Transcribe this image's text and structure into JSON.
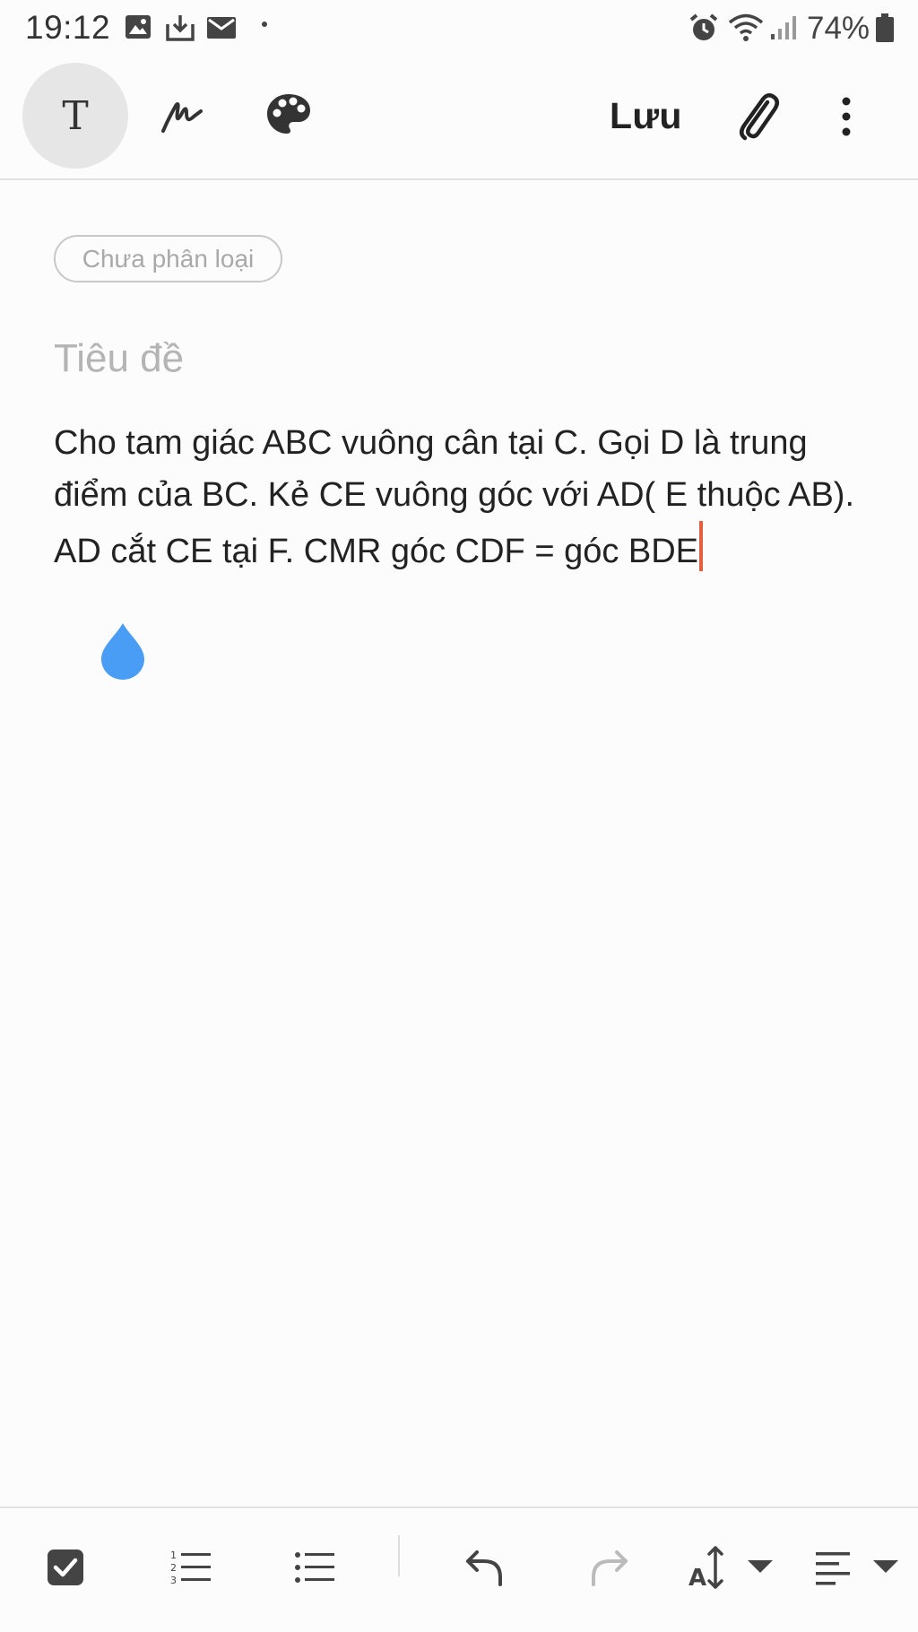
{
  "status_bar": {
    "time": "19:12",
    "battery": "74%",
    "icons": [
      "image-icon",
      "download-icon",
      "mail-icon",
      "alarm-icon",
      "wifi-icon",
      "signal-icon",
      "battery-icon"
    ]
  },
  "toolbar": {
    "text_tool_glyph": "T",
    "save_label": "Lưu",
    "icons": [
      "text-mode-icon",
      "handwriting-icon",
      "palette-icon",
      "paperclip-icon",
      "more-vert-icon"
    ]
  },
  "note": {
    "category": "Chưa phân loại",
    "title_placeholder": "Tiêu đề",
    "body": "Cho tam giác ABC vuông cân tại C. Gọi D là trung điểm của BC. Kẻ CE vuông góc với AD( E thuộc AB). AD cắt CE tại F. CMR góc CDF = góc BDE"
  },
  "bottom_bar": {
    "icons": [
      "checkbox-icon",
      "numbered-list-icon",
      "bullet-list-icon",
      "undo-icon",
      "redo-icon",
      "text-size-icon",
      "align-icon"
    ]
  },
  "colors": {
    "cursor": "#e06040",
    "handle": "#4a9df5",
    "active_tool_bg": "#e6e6e6"
  }
}
